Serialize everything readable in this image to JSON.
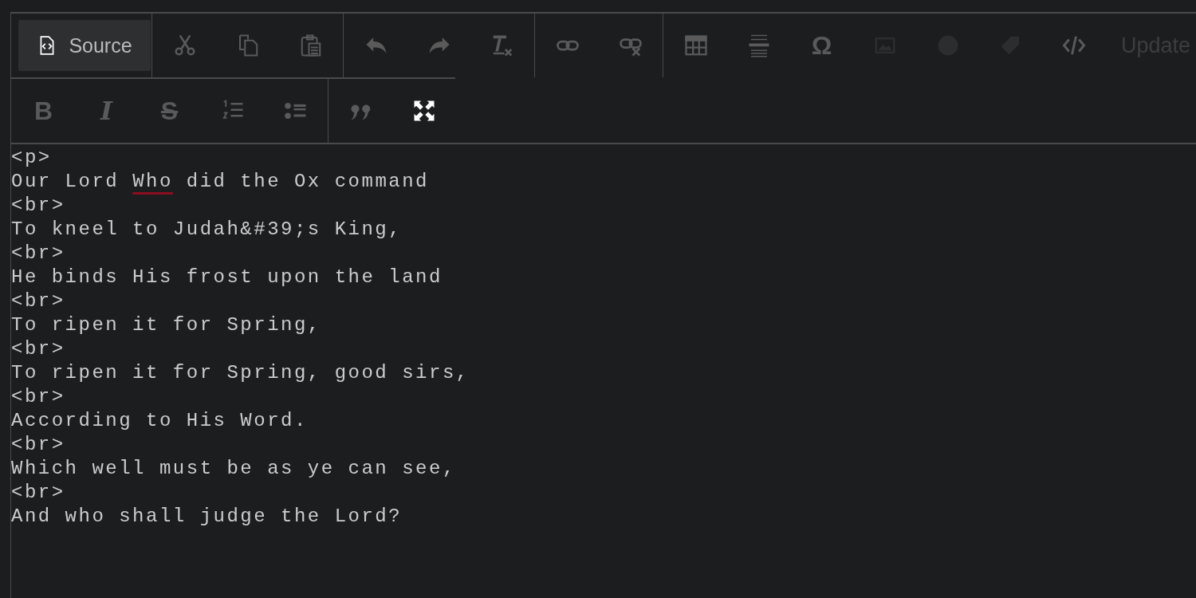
{
  "toolbar": {
    "rows": [
      [
        {
          "items": [
            {
              "kind": "toggle",
              "label": "Source",
              "on": true
            }
          ]
        },
        {
          "items": [
            {
              "kind": "icon",
              "disabled": true
            },
            {
              "kind": "icon",
              "disabled": true
            },
            {
              "kind": "icon",
              "disabled": true
            }
          ]
        },
        {
          "items": [
            {
              "kind": "icon",
              "disabled": true
            },
            {
              "kind": "icon",
              "disabled": true
            },
            {
              "kind": "icon",
              "disabled": true
            }
          ]
        },
        {
          "items": [
            {
              "kind": "icon",
              "disabled": true
            },
            {
              "kind": "icon",
              "disabled": true
            }
          ]
        },
        {
          "items": [
            {
              "kind": "icon",
              "disabled": true
            },
            {
              "kind": "icon",
              "disabled": true
            },
            {
              "kind": "glyph",
              "label": "Ω",
              "disabled": true
            },
            {
              "kind": "icon",
              "disabled": true
            },
            {
              "kind": "icon",
              "disabled": true
            },
            {
              "kind": "icon",
              "disabled": true
            },
            {
              "kind": "icon",
              "disabled": true
            },
            {
              "kind": "label",
              "label": "Update",
              "disabled": true
            }
          ]
        }
      ],
      [
        {
          "items": [
            {
              "kind": "glyph",
              "label": "B",
              "disabled": true
            },
            {
              "kind": "glyph",
              "label": "I",
              "disabled": true
            },
            {
              "kind": "glyph",
              "label": "S",
              "disabled": true
            },
            {
              "kind": "icon",
              "disabled": true
            },
            {
              "kind": "icon",
              "disabled": true
            }
          ]
        },
        {
          "items": [
            {
              "kind": "icon",
              "disabled": true
            },
            {
              "kind": "icon",
              "disabled": false
            }
          ]
        }
      ]
    ]
  },
  "source_lines": [
    [
      {
        "text": "<p>"
      }
    ],
    [
      {
        "text": "Our Lord "
      },
      {
        "text": "Who",
        "misspelled": true
      },
      {
        "text": " did the Ox command"
      }
    ],
    [
      {
        "text": "<br>"
      }
    ],
    [
      {
        "text": "To kneel to Judah&#39;s King,"
      }
    ],
    [
      {
        "text": "<br>"
      }
    ],
    [
      {
        "text": "He binds His frost upon the land"
      }
    ],
    [
      {
        "text": "<br>"
      }
    ],
    [
      {
        "text": "To ripen it for Spring,"
      }
    ],
    [
      {
        "text": "<br>"
      }
    ],
    [
      {
        "text": "To ripen it for Spring, good sirs,"
      }
    ],
    [
      {
        "text": "<br>"
      }
    ],
    [
      {
        "text": "According to His Word."
      }
    ],
    [
      {
        "text": "<br>"
      }
    ],
    [
      {
        "text": "Which well must be as ye can see,"
      }
    ],
    [
      {
        "text": "<br>"
      }
    ],
    [
      {
        "text": "And who shall judge the Lord?"
      }
    ]
  ]
}
